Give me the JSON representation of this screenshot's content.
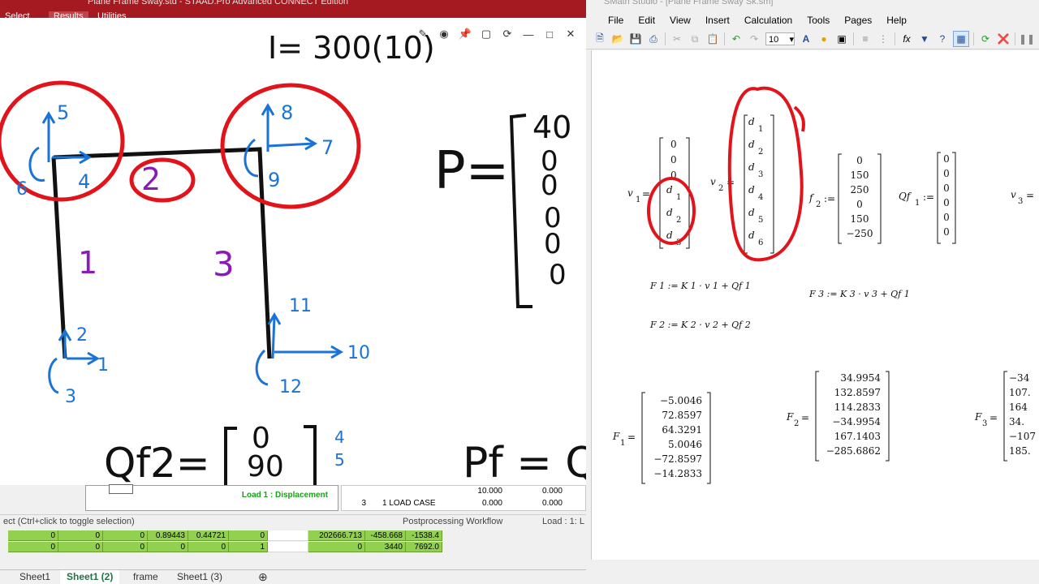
{
  "staad": {
    "title": "Plane Frame Sway.std - STAAD.Pro Advanced CONNECT Edition",
    "tabs": [
      "Select",
      "Results",
      "Utilities"
    ],
    "load_label": "Load 1 : Displacement",
    "status": {
      "hint": "ect (Ctrl+click to toggle selection)",
      "workflow": "Postprocessing Workflow",
      "load": "Load : 1: L"
    },
    "mini_table": {
      "row_top": [
        "10.000",
        "0.000"
      ],
      "row_bottom": [
        "3",
        "1 LOAD CASE",
        "0.000",
        "0.000"
      ]
    },
    "grid_rows": [
      [
        "0",
        "0",
        "0",
        "0.89443",
        "0.44721",
        "0",
        "",
        "202666.713",
        "-458.668",
        "-1538.4"
      ],
      [
        "0",
        "0",
        "0",
        "0",
        "0",
        "1",
        "",
        "0",
        "3440",
        "7692.0"
      ]
    ],
    "sheet_tabs": [
      "Sheet1",
      "Sheet1 (2)",
      "frame",
      "Sheet1 (3)"
    ],
    "active_sheet": 1
  },
  "whiteboard": {
    "tools": [
      "pen-tool",
      "record",
      "pin",
      "crop",
      "refresh",
      "minimize",
      "maximize",
      "close"
    ],
    "members": [
      "1",
      "2",
      "3"
    ],
    "dofs": [
      "1",
      "2",
      "3",
      "4",
      "5",
      "6",
      "7",
      "8",
      "9",
      "10",
      "11",
      "12"
    ],
    "p_label": "P=",
    "p_values": [
      "40",
      "0",
      "0",
      "0",
      "0",
      "0"
    ],
    "qf2_label": "Qf2=",
    "qf2_values": [
      "0",
      "90"
    ],
    "qf2_side": [
      "4",
      "5"
    ],
    "pf_label": "Pf = Qf",
    "top_partial": "I= 300(10)"
  },
  "smath": {
    "title": "SMath Studio - [Plane Frame Sway Sk.sm]",
    "menu": [
      "File",
      "Edit",
      "View",
      "Insert",
      "Calculation",
      "Tools",
      "Pages",
      "Help"
    ],
    "font_size": "10",
    "v1": {
      "label": "v",
      "sub": "1",
      "values": [
        "0",
        "0",
        "0",
        "d",
        "d",
        "d"
      ],
      "subs": [
        "",
        "",
        "",
        "1",
        "2",
        "3"
      ]
    },
    "v2": {
      "label": "v",
      "sub": "2",
      "values": [
        "d",
        "d",
        "d",
        "d",
        "d",
        "d"
      ],
      "subs": [
        "1",
        "2",
        "3",
        "4",
        "5",
        "6"
      ]
    },
    "f2": {
      "label": "f",
      "sub": "2",
      "values": [
        "0",
        "150",
        "250",
        "0",
        "150",
        "−250"
      ]
    },
    "qf1": {
      "label": "Qf",
      "sub": "1",
      "values": [
        "0",
        "0",
        "0",
        "0",
        "0",
        "0"
      ]
    },
    "v3_label": "v",
    "v3_sub": "3",
    "eq_F1": "F 1 := K 1 · v 1 + Qf 1",
    "eq_F2": "F 2 := K 2 · v 2 + Qf 2",
    "eq_F3": "F 3 := K 3 · v 3 + Qf 1",
    "F1": {
      "values": [
        "−5.0046",
        "72.8597",
        "64.3291",
        "5.0046",
        "−72.8597",
        "−14.2833"
      ]
    },
    "F2": {
      "values": [
        "34.9954",
        "132.8597",
        "114.2833",
        "−34.9954",
        "167.1403",
        "−285.6862"
      ]
    },
    "F3": {
      "values": [
        "−34",
        "107.",
        "164",
        "34.",
        "−107",
        "185."
      ]
    }
  },
  "colors": {
    "staad_red": "#a51a21",
    "ink_black": "#111111",
    "ink_red": "#e0141a",
    "ink_blue": "#1a73d6",
    "ink_purple": "#8a1bb8",
    "grid_green": "#92d050"
  }
}
